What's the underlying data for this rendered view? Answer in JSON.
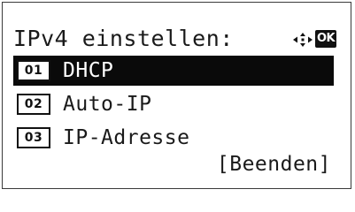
{
  "header": {
    "title": "IPv4 einstellen:",
    "nav_icon": "four-way-arrow-icon",
    "ok_label": "OK"
  },
  "menu": {
    "selected_index": 0,
    "items": [
      {
        "number": "01",
        "label": "DHCP"
      },
      {
        "number": "02",
        "label": "Auto-IP"
      },
      {
        "number": "03",
        "label": "IP-Adresse"
      }
    ]
  },
  "softkey": {
    "label": "[Beenden]"
  },
  "colors": {
    "selection_background": "#0a0a0a",
    "text": "#1a1a1a",
    "background": "#ffffff"
  }
}
